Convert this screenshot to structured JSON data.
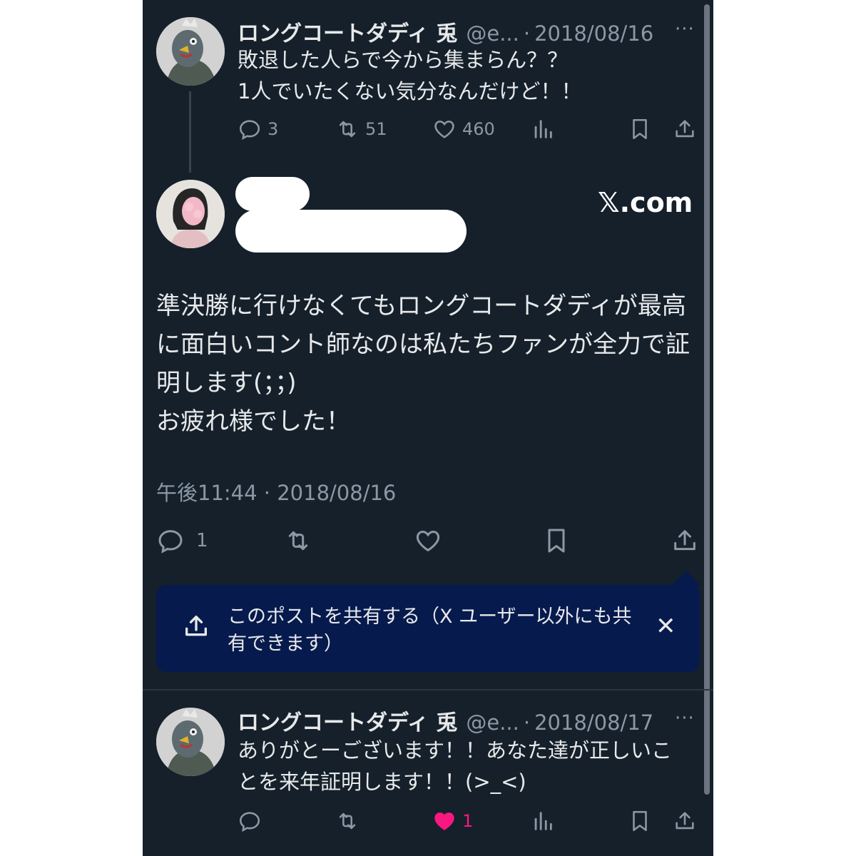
{
  "tweet1": {
    "name": "ロングコートダディ 兎",
    "handle": "@e...",
    "sep": "·",
    "date": "2018/08/16",
    "more": "···",
    "text": "敗退した人らで今から集まらん？？\n1人でいたくない気分なんだけど！！",
    "replies": "3",
    "retweets": "51",
    "likes": "460"
  },
  "watermark": "𝕏.com",
  "main_tweet": {
    "text": "準決勝に行けなくてもロングコートダディが最高\nに面白いコント師なのは私たちファンが全力で証\n明します(；；)\nお疲れ様でした！",
    "timestamp": "午後11:44 · 2018/08/16",
    "replies": "1"
  },
  "share_banner": {
    "text": "このポストを共有する（X ユーザー以外にも共有できます）",
    "close": "✕"
  },
  "tweet3": {
    "name": "ロングコートダディ 兎",
    "handle": "@e...",
    "sep": "·",
    "date": "2018/08/17",
    "more": "···",
    "text": "ありがとーございます！！あなた達が正しいこ\nとを来年証明します！！(>_<)",
    "likes": "1"
  },
  "colors": {
    "background": "#15202b",
    "text": "#e7e9ea",
    "muted": "#8b98a5",
    "like": "#f91880",
    "banner": "#061a4d"
  }
}
